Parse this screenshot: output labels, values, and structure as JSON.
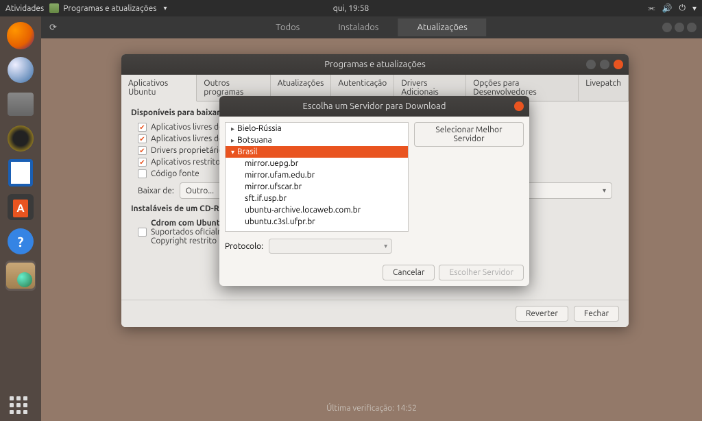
{
  "topbar": {
    "activities": "Atividades",
    "app_name": "Programas e atualizações",
    "clock": "qui, 19:58"
  },
  "fx": {
    "tabs": [
      "Todos",
      "Instalados",
      "Atualizações"
    ],
    "active_tab": 2
  },
  "main": {
    "title": "Programas e atualizações",
    "tabs": [
      "Aplicativos Ubuntu",
      "Outros programas",
      "Atualizações",
      "Autenticação",
      "Drivers Adicionais",
      "Opções para Desenvolvedores",
      "Livepatch"
    ],
    "active_tab": 0,
    "section_available": "Disponíveis para baixar",
    "checks": [
      {
        "label": "Aplicativos livres de",
        "checked": true
      },
      {
        "label": "Aplicativos livres de",
        "checked": true
      },
      {
        "label": "Drivers proprietário",
        "checked": true
      },
      {
        "label": "Aplicativos restrito",
        "checked": true
      },
      {
        "label": "Código fonte",
        "checked": false
      }
    ],
    "download_from_label": "Baixar de:",
    "download_from_value": "Outro...",
    "section_cdrom": "Instaláveis de um CD-R",
    "cdrom_title": "Cdrom com Ubuntu",
    "cdrom_sub1": "Suportados oficialm",
    "cdrom_sub2": "Copyright restrito",
    "revert": "Reverter",
    "close": "Fechar"
  },
  "modal": {
    "title": "Escolha um Servidor para Download",
    "best_server": "Selecionar Melhor Servidor",
    "countries": [
      {
        "name": "Bielo-Rússia",
        "expanded": false
      },
      {
        "name": "Botsuana",
        "expanded": false
      },
      {
        "name": "Brasil",
        "expanded": true,
        "selected": true,
        "mirrors": [
          "mirror.uepg.br",
          "mirror.ufam.edu.br",
          "mirror.ufscar.br",
          "sft.if.usp.br",
          "ubuntu-archive.locaweb.com.br",
          "ubuntu.c3sl.ufpr.br"
        ]
      }
    ],
    "protocol_label": "Protocolo:",
    "cancel": "Cancelar",
    "choose": "Escolher Servidor"
  },
  "status": "Última verificação: 14:52"
}
